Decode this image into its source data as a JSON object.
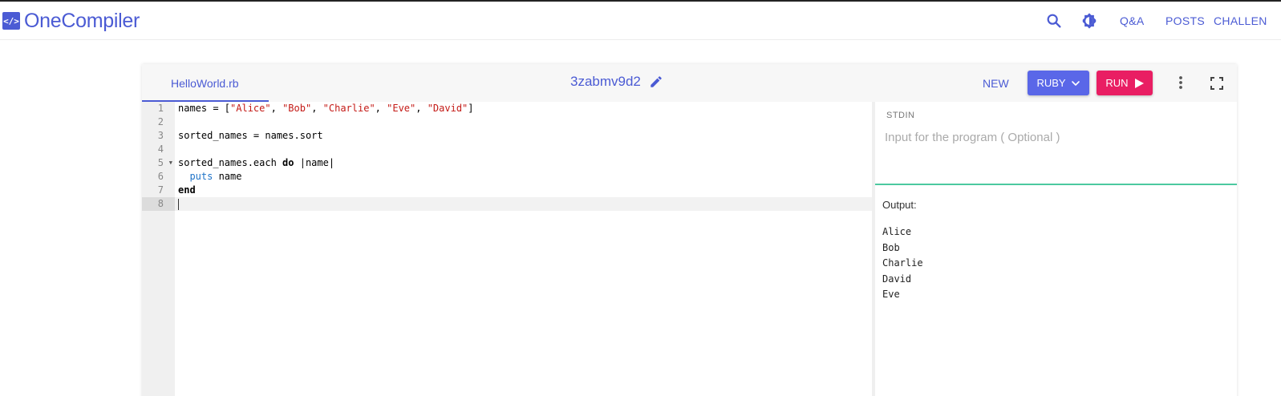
{
  "header": {
    "logo_mark": "</>",
    "logo_text": "OneCompiler",
    "nav": [
      "Q&A",
      "POSTS",
      "CHALLEN"
    ]
  },
  "toolbar": {
    "tab_label": "HelloWorld.rb",
    "title": "3zabmv9d2",
    "new_label": "NEW",
    "language_label": "RUBY",
    "run_label": "RUN"
  },
  "editor": {
    "line_numbers": [
      "1",
      "2",
      "3",
      "4",
      "5",
      "6",
      "7",
      "8"
    ],
    "lines": [
      "names = [\"Alice\", \"Bob\", \"Charlie\", \"Eve\", \"David\"]",
      "",
      "sorted_names = names.sort",
      "",
      "sorted_names.each do |name|",
      "  puts name",
      "end",
      ""
    ],
    "active_line": 8
  },
  "stdin": {
    "label": "STDIN",
    "placeholder": "Input for the program ( Optional )"
  },
  "output": {
    "label": "Output:",
    "lines": [
      "Alice",
      "Bob",
      "Charlie",
      "David",
      "Eve"
    ]
  },
  "colors": {
    "brand": "#4b5bd4",
    "language_button": "#5a67e8",
    "run_button": "#e91e63",
    "stdin_border": "#4cc9a0",
    "string": "#c41a16",
    "builtin": "#1e73c8"
  },
  "icons": [
    "search-icon",
    "theme-toggle-icon",
    "edit-pencil-icon",
    "chevron-down-icon",
    "play-icon",
    "more-vertical-icon",
    "fullscreen-icon"
  ]
}
